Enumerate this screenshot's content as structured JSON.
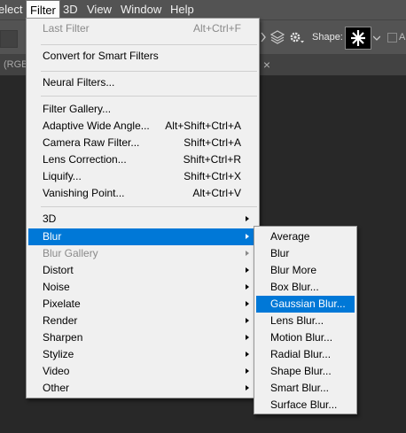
{
  "menubar": {
    "items": [
      {
        "label": "elect"
      },
      {
        "label": "Filter"
      },
      {
        "label": "3D"
      },
      {
        "label": "View"
      },
      {
        "label": "Window"
      },
      {
        "label": "Help"
      }
    ]
  },
  "options_bar": {
    "shapes_label": "Shape:",
    "checkbox_label": "Al"
  },
  "tabbar": {
    "doc_tab_label": "(RGB",
    "close_glyph": "×"
  },
  "filter_menu": {
    "items": [
      {
        "label": "Last Filter",
        "shortcut": "Alt+Ctrl+F",
        "disabled": true
      },
      {
        "label": "Convert for Smart Filters",
        "shortcut": ""
      },
      {
        "label": "Neural Filters...",
        "shortcut": ""
      },
      {
        "label": "Filter Gallery...",
        "shortcut": ""
      },
      {
        "label": "Adaptive Wide Angle...",
        "shortcut": "Alt+Shift+Ctrl+A"
      },
      {
        "label": "Camera Raw Filter...",
        "shortcut": "Shift+Ctrl+A"
      },
      {
        "label": "Lens Correction...",
        "shortcut": "Shift+Ctrl+R"
      },
      {
        "label": "Liquify...",
        "shortcut": "Shift+Ctrl+X"
      },
      {
        "label": "Vanishing Point...",
        "shortcut": "Alt+Ctrl+V"
      },
      {
        "label": "3D",
        "submenu": true
      },
      {
        "label": "Blur",
        "submenu": true,
        "highlighted": true
      },
      {
        "label": "Blur Gallery",
        "submenu": true,
        "disabled": true
      },
      {
        "label": "Distort",
        "submenu": true
      },
      {
        "label": "Noise",
        "submenu": true
      },
      {
        "label": "Pixelate",
        "submenu": true
      },
      {
        "label": "Render",
        "submenu": true
      },
      {
        "label": "Sharpen",
        "submenu": true
      },
      {
        "label": "Stylize",
        "submenu": true
      },
      {
        "label": "Video",
        "submenu": true
      },
      {
        "label": "Other",
        "submenu": true
      }
    ]
  },
  "blur_submenu": {
    "items": [
      {
        "label": "Average"
      },
      {
        "label": "Blur"
      },
      {
        "label": "Blur More"
      },
      {
        "label": "Box Blur..."
      },
      {
        "label": "Gaussian Blur...",
        "highlighted": true
      },
      {
        "label": "Lens Blur..."
      },
      {
        "label": "Motion Blur..."
      },
      {
        "label": "Radial Blur..."
      },
      {
        "label": "Shape Blur..."
      },
      {
        "label": "Smart Blur..."
      },
      {
        "label": "Surface Blur..."
      }
    ]
  },
  "colors": {
    "highlight": "#0078d7",
    "menu_bg": "#f0f0f0",
    "app_bg": "#282828",
    "chrome": "#535353"
  }
}
